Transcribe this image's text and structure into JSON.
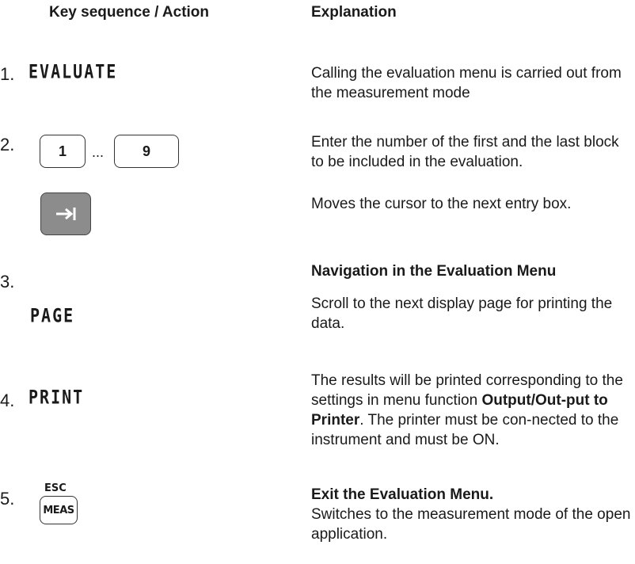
{
  "header": {
    "key_col": "Key sequence / Action",
    "explain_col": "Explanation"
  },
  "steps": [
    {
      "number": "1.",
      "softkey": "EVALUATE",
      "explanation": "Calling the evaluation menu is carried out from the measurement mode"
    },
    {
      "number": "2.",
      "key_first": "1",
      "ellipsis": "...",
      "key_last": "9",
      "explanation": "Enter the number of the first and the last block to be included in the evaluation.",
      "tab_explanation": "Moves the cursor to the next entry box."
    },
    {
      "number": "3.",
      "softkey": "PAGE",
      "heading": "Navigation in  the Evaluation Menu",
      "explanation": "Scroll to the next display page for printing the data."
    },
    {
      "number": "4.",
      "softkey": "PRINT",
      "explanation_part1": "The results will be printed corresponding to the settings in menu function ",
      "explanation_bold": "Output/Out-put to Printer",
      "explanation_part2": ". The printer must be con-nected to the instrument and must be ON."
    },
    {
      "number": "5.",
      "key_top": "ESC",
      "key_label": "MEAS",
      "heading": "Exit the Evaluation Menu.",
      "explanation": "Switches to the measurement mode of the open application."
    }
  ],
  "icons": {
    "tab_key": "tab-arrow-icon"
  }
}
